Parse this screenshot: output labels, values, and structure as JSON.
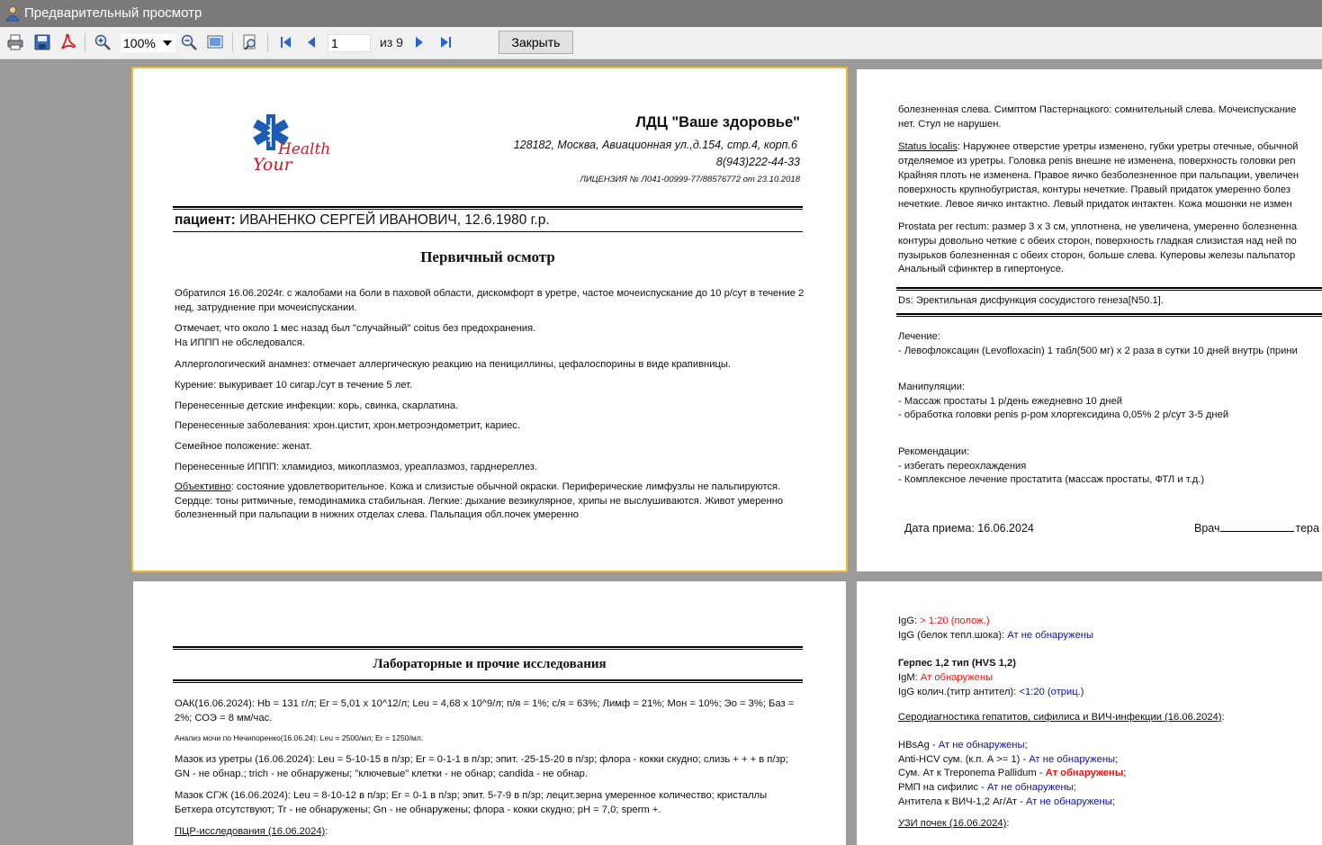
{
  "window": {
    "title": "Предварительный просмотр"
  },
  "toolbar": {
    "zoom_value": "100%",
    "page_number": "1",
    "page_of": "из 9",
    "close_label": "Закрыть"
  },
  "page1": {
    "clinic_name": "ЛДЦ \"Ваше здоровье\"",
    "address": "128182, Москва, Авиационная ул.,д.154, стр.4, корп.6",
    "phone": "8(943)222-44-33",
    "license": "ЛИЦЕНЗИЯ № Л041-00999-77/88576772 от 23.10.2018",
    "logo_word1": "Your",
    "logo_word2": "Health",
    "patient_label": "пациент:",
    "patient_name": "ИВАНЕНКО СЕРГЕЙ ИВАНОВИЧ, 12.6.1980 г.р.",
    "heading": "Первичный осмотр",
    "paragraphs": [
      "Обратился 16.06.2024г. с жалобами на боли в паховой области, дискомфорт в уретре, частое мочеиспускание до 10 р/сут в течение 2 нед, затруднение при мочеиспускании.",
      "Отмечает, что около 1 мес назад был \"случайный\" coitus без предохранения.",
      "На ИППП не обследовался.",
      "Аллергологический анамнез: отмечает аллергическую реакцию на пенициллины, цефалоспорины в виде крапивницы.",
      "Курение: выкуривает 10 сигар./сут в течение 5 лет.",
      "Перенесенные детские инфекции: корь, свинка, скарлатина.",
      "Перенесенные заболевания:  хрон.цистит,  хрон.метроэндометрит, кариес.",
      "Семейное положение: женат.",
      "Перенесенные ИППП: хламидиоз, микоплазмоз, уреаплазмоз, гарднереллез."
    ],
    "objective_label": "Объективно",
    "objective_text": ": состояние удовлетворительное. Кожа и слизистые обычной окраски. Периферические лимфузлы не пальпируются. Сердце: тоны ритмичные, гемодинамика стабильная. Легкие: дыхание везикулярное, хрипы не выслушиваются. Живот умеренно болезненный при пальпации в нижних отделах слева. Пальпация обл.почек умеренно"
  },
  "page2": {
    "lines_top": [
      "болезненная слева. Симптом Пастернацкого: сомнительный слева. Мочеиспускание",
      "нет. Стул не нарушен."
    ],
    "status_label": "Status localis",
    "status_lines": [
      ": Наружнее отверстие уретры изменено, губки уретры отечные, обычной",
      "отделяемое из уретры. Головка penis внешне не изменена, поверхность головки pen",
      "Крайняя плоть не изменена. Правое яичко безболезненное при пальпации, увеличен",
      "поверхность крупнобугристая, контуры нечеткие. Правый придаток умеренно болез",
      "нечеткие. Левое яичко интактно. Левый придаток интактен. Кожа мошонки не измен"
    ],
    "prostata_lines": [
      "Prostata per rectum: размер 3 х 3 см, уплотнена, не увеличена, умеренно болезненна",
      "контуры довольно четкие с обеих сторон, поверхность гладкая слизистая над ней по",
      "пузырьков болезненная с обеих сторон, больше слева. Куперовы железы пальпатор",
      "Анальный сфинктер в гипертонусе."
    ],
    "diagnosis": "Ds: Эректильная дисфункция сосудистого генеза[N50.1].",
    "treatment_title": "Лечение:",
    "treatment_lines": [
      "- Левофлоксацин (Levofloxacin) 1 табл(500 мг) х 2 раза в сутки 10 дней внутрь (прини"
    ],
    "manip_title": "Манипуляции:",
    "manip_lines": [
      "- Массаж простаты 1 р/день ежедневно 10 дней",
      "- обработка головки penis р-ром хлоргексидина 0,05% 2 р/сут 3-5 дней"
    ],
    "rec_title": "Рекомендации:",
    "rec_lines": [
      "- избегать переохлаждения",
      "- Комплексное лечение простатита (массаж простаты, ФТЛ и т.д.)"
    ],
    "visit_date": "Дата приема:  16.06.2024",
    "doctor_label": "Врач",
    "doctor_suffix": "тера"
  },
  "page3": {
    "heading": "Лабораторные и прочие исследования",
    "oak": "ОАК(16.06.2024): Hb = 131 г/л; Er = 5,01 х 10^12/л; Leu = 4,68 х 10^9/л; п/я = 1%; с/я = 63%; Лимф = 21%; Мон = 10%; Эо = 3%; Баз = 2%; СОЭ = 8 мм/час.",
    "urine": "Анализ мочи по Нечипоренко(16.06.24): Leu = 2500/мл; Er = 1250/мл.",
    "smear_urethra": "Мазок из уретры (16.06.2024): Leu = 5-10-15 в п/зр; Er = 0-1-1 в п/зр; эпит. -25-15-20 в п/зр; флора - кокки скудно; слизь + + + в п/зр; GN - не обнар.; trich - не обнаружены; \"ключевые\" клетки - не обнар; candida - не обнар.",
    "smear_sgzh": "Мазок СГЖ (16.06.2024): Leu = 8-10-12 в п/зр; Er = 0-1 в п/зр; эпит. 5-7-9 в п/зр; лецит.зерна умеренное количество; кристаллы Бетхера отсутствуют; Tr - не обнаружены; Gn - не обнаружены; флора - кокки скудно; pH = 7,0; sperm +.",
    "pcr_label": "ПЦР-исследования (16.06.2024)",
    "pcr_colon": ":"
  },
  "page4": {
    "igg1_label": "IgG: ",
    "igg1_value": "> 1:20 (полож.)",
    "igg2_label": "IgG (белок тепл.шока): ",
    "igg2_value": "Ат не обнаружены",
    "herpes_title": "Герпес 1,2 тип (HVS 1,2)",
    "igm_label": "IgM: ",
    "igm_value": "Ат обнаружены",
    "igg3_label": "IgG колич.(титр антител): ",
    "igg3_value": "<1:20 (отриц.)",
    "sero_title": "Серодиагностика гепатитов, сифилиса и ВИЧ-инфекции (16.06.2024)",
    "sero_colon": ":",
    "rows": [
      {
        "label": "HBsAg - ",
        "value": "Ат не обнаружены",
        "tail": ";"
      },
      {
        "label": "Anti-HCV сум. (к.п. А >= 1) - ",
        "value": "Ат не обнаружены",
        "tail": ";"
      },
      {
        "label": "Сум. Ат к Treponema Pallidum - ",
        "value": "Ат обнаружены",
        "tail": ";"
      },
      {
        "label": "РМП на сифилис - ",
        "value": "Ат не обнаружены",
        "tail": ";"
      },
      {
        "label": "Антитела к ВИЧ-1,2 Аг/Ат - ",
        "value": "Ат не обнаружены",
        "tail": ";"
      }
    ],
    "uzi_label": "УЗИ почек (16.06.2024)",
    "uzi_colon": ":"
  },
  "colors": {
    "selection": "#f0b830",
    "negative": "#12129a",
    "positive": "#e11111",
    "acrobat": "#d32020",
    "nav_blue": "#2a63c8",
    "star_of_life": "#1e5bb5",
    "logo_text": "#c0202a"
  },
  "icons": [
    "app-icon",
    "print-icon",
    "save-icon",
    "pdf-icon",
    "zoom-in-icon",
    "zoom-out-icon",
    "page-fit-icon",
    "find-icon",
    "first-page-icon",
    "prev-page-icon",
    "next-page-icon",
    "last-page-icon",
    "star-of-life-icon"
  ]
}
